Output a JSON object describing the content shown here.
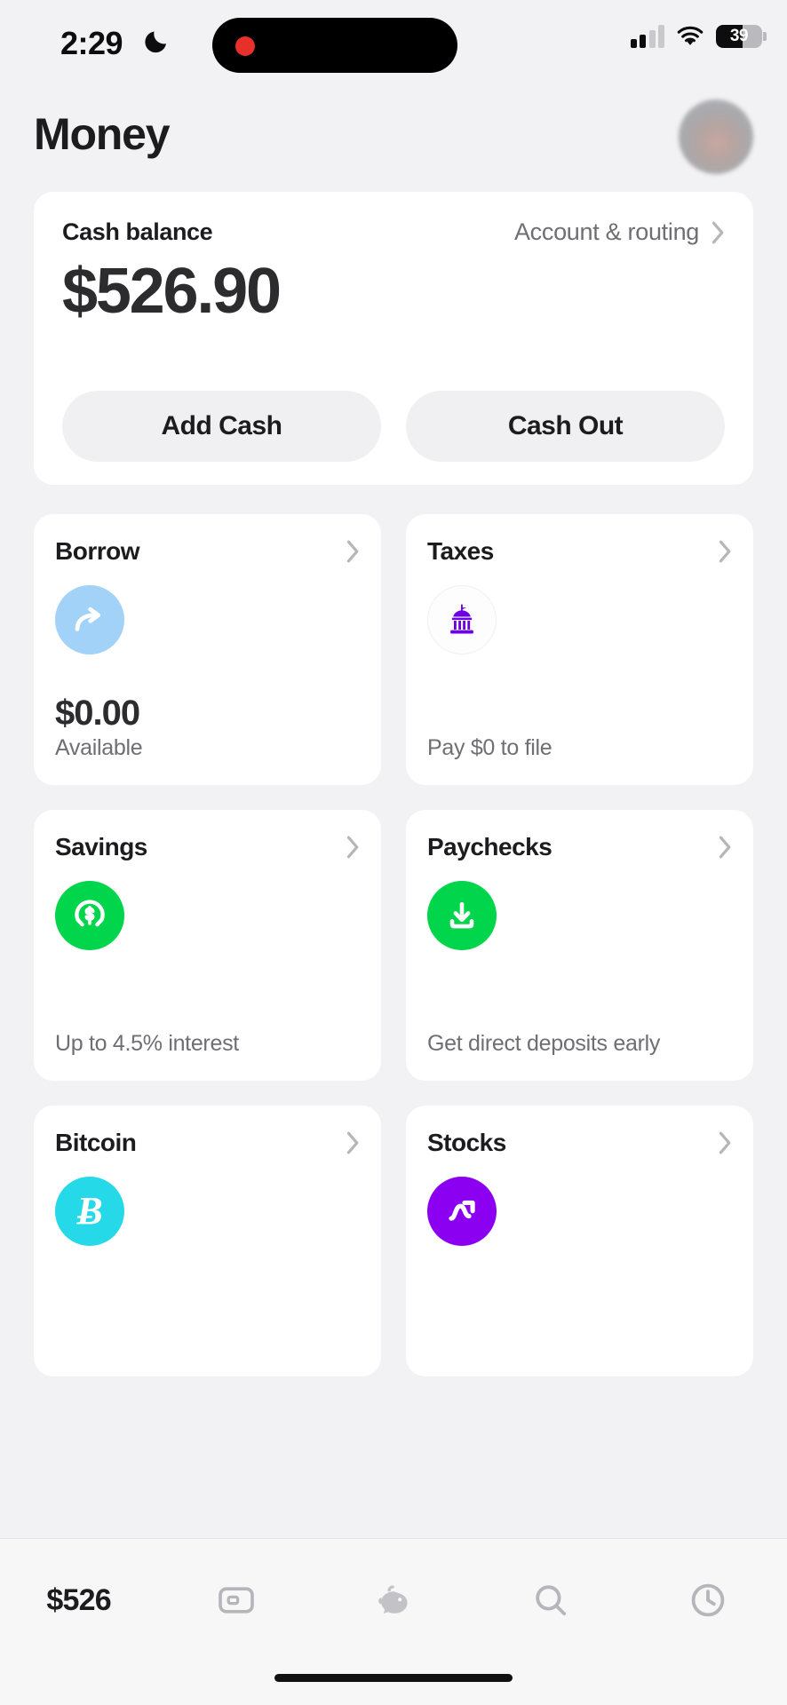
{
  "status_bar": {
    "time": "2:29",
    "dnd_icon": "moon-icon",
    "signal_icon": "cellular-signal-icon",
    "signal_bars_active": 2,
    "wifi_icon": "wifi-icon",
    "battery_level": "39",
    "battery_icon": "battery-icon",
    "recording_indicator": "recording-dot-icon"
  },
  "header": {
    "title": "Money",
    "avatar": "profile-avatar"
  },
  "balance": {
    "label": "Cash balance",
    "amount": "$526.90",
    "account_link": "Account & routing",
    "chevron_icon": "chevron-right-icon",
    "add_cash": "Add Cash",
    "cash_out": "Cash Out"
  },
  "tiles": [
    {
      "title": "Borrow",
      "icon": "curved-arrow-icon",
      "icon_bg": "#a2d2f7",
      "value": "$0.00",
      "sub": "Available",
      "chevron_icon": "chevron-right-icon"
    },
    {
      "title": "Taxes",
      "icon": "government-building-icon",
      "icon_bg": "#fdfdfd",
      "icon_color": "#6a00e0",
      "value": "",
      "sub": "Pay $0 to file",
      "chevron_icon": "chevron-right-icon"
    },
    {
      "title": "Savings",
      "icon": "savings-dollar-circle-icon",
      "icon_bg": "#00d54b",
      "value": "",
      "sub": "Up to 4.5% interest",
      "chevron_icon": "chevron-right-icon"
    },
    {
      "title": "Paychecks",
      "icon": "direct-deposit-download-icon",
      "icon_bg": "#00d54b",
      "value": "",
      "sub": "Get direct deposits early",
      "chevron_icon": "chevron-right-icon"
    },
    {
      "title": "Bitcoin",
      "icon": "bitcoin-icon",
      "icon_bg": "#25d9e8",
      "icon_glyph": "Ƀ",
      "value": "",
      "sub": "",
      "chevron_icon": "chevron-right-icon"
    },
    {
      "title": "Stocks",
      "icon": "stocks-trend-icon",
      "icon_bg": "#8b00f0",
      "value": "",
      "sub": "",
      "chevron_icon": "chevron-right-icon"
    }
  ],
  "tabbar": {
    "items": [
      {
        "label": "$526",
        "icon": "money-balance-tab"
      },
      {
        "label": "",
        "icon": "card-tab-icon"
      },
      {
        "label": "",
        "icon": "piggy-bank-tab-icon"
      },
      {
        "label": "",
        "icon": "search-tab-icon"
      },
      {
        "label": "",
        "icon": "activity-clock-tab-icon"
      }
    ]
  },
  "colors": {
    "background": "#f2f2f4",
    "card": "#ffffff",
    "accent_green": "#00d54b",
    "accent_purple": "#8b00f0",
    "accent_cyan": "#25d9e8",
    "accent_blue": "#a2d2f7",
    "text_primary": "#1c1c1e",
    "text_secondary": "#6e6e73"
  }
}
